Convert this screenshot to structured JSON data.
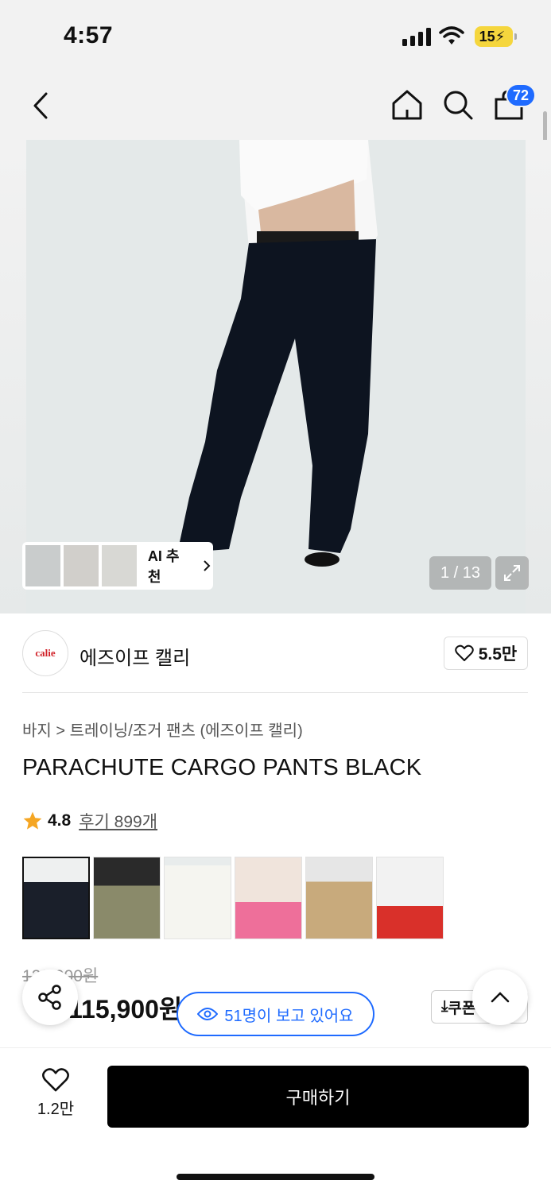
{
  "status": {
    "time": "4:57",
    "battery": "15"
  },
  "nav": {
    "cart_count": "72"
  },
  "gallery": {
    "counter": "1 / 13",
    "ai_label": "AI 추천"
  },
  "brand": {
    "logo_text": "calie",
    "name": "에즈이프 캘리",
    "likes": "5.5만"
  },
  "product": {
    "breadcrumb": "바지 > 트레이닝/조거 팬츠 (에즈이프 캘리)",
    "title": "PARACHUTE CARGO PANTS BLACK",
    "rating": "4.8",
    "reviews": "후기 899개",
    "original_price": "129,000원",
    "sale_price": "115,900원",
    "coupon_label": "쿠폰"
  },
  "viewers": "51명이 보고 있어요",
  "bottom": {
    "wish_count": "1.2만",
    "buy_label": "구매하기"
  },
  "colors": {
    "accent": "#1f6bff",
    "star": "#f5a623"
  }
}
